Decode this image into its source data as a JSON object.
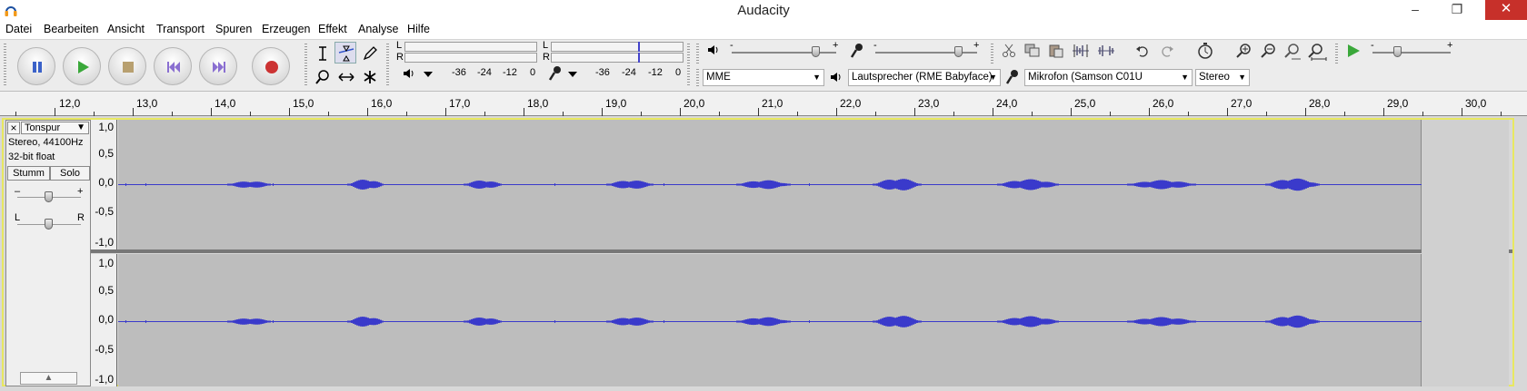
{
  "window": {
    "title": "Audacity",
    "minimize": "–",
    "restore": "❐",
    "close": "✕"
  },
  "menu": [
    "Datei",
    "Bearbeiten",
    "Ansicht",
    "Transport",
    "Spuren",
    "Erzeugen",
    "Effekt",
    "Analyse",
    "Hilfe"
  ],
  "meters": {
    "playback_channels": [
      "L",
      "R"
    ],
    "record_channels": [
      "L",
      "R"
    ],
    "playback_scale": [
      "-36",
      "-24",
      "-12",
      "0"
    ],
    "record_scale": [
      "-36",
      "-24",
      "-12",
      "0"
    ]
  },
  "mixer": {
    "output_minus": "-",
    "output_plus": "+",
    "input_minus": "-",
    "input_plus": "+",
    "play_speed_minus": "-",
    "play_speed_plus": "+"
  },
  "devices": {
    "host": "MME",
    "output": "Lautsprecher (RME Babyface)",
    "input": "Mikrofon (Samson C01U",
    "channels": "Stereo"
  },
  "ruler": [
    "12,0",
    "13,0",
    "14,0",
    "15,0",
    "16,0",
    "17,0",
    "18,0",
    "19,0",
    "20,0",
    "21,0",
    "22,0",
    "23,0",
    "24,0",
    "25,0",
    "26,0",
    "27,0",
    "28,0",
    "29,0",
    "30,0"
  ],
  "track": {
    "close": "×",
    "name": "Tonspur",
    "info_line1": "Stereo, 44100Hz",
    "info_line2": "32-bit float",
    "mute": "Stumm",
    "solo": "Solo",
    "gain_minus": "–",
    "gain_plus": "+",
    "pan_left": "L",
    "pan_right": "R",
    "collapse": "▲"
  },
  "amplitude_scale": [
    "1,0",
    "0,5",
    "0,0",
    "-0,5",
    "-1,0"
  ],
  "colors": {
    "waveform": "#3a3acb",
    "wave_bg": "#bdbdbd",
    "selection_border": "#e8e860",
    "record": "#c33"
  }
}
